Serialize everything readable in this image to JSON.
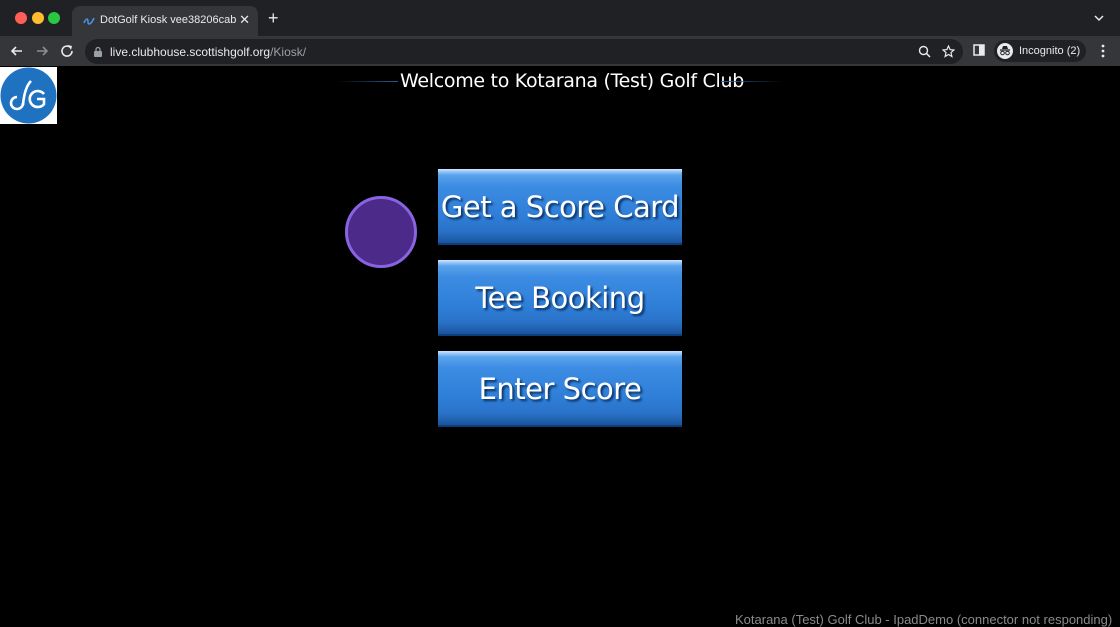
{
  "browser": {
    "tab_title": "DotGolf Kiosk vee38206cab",
    "tab_close": "✕",
    "new_tab": "+",
    "url_host": "live.clubhouse.scottishgolf.org",
    "url_path": "/Kiosk/",
    "profile_label": "Incognito (2)"
  },
  "page": {
    "welcome": "Welcome to Kotarana (Test) Golf Club",
    "buttons": {
      "score_card": "Get a Score Card",
      "tee_booking": "Tee Booking",
      "enter_score": "Enter Score"
    },
    "status": "Kotarana (Test) Golf Club - IpadDemo (connector not responding)"
  },
  "colors": {
    "button_blue": "#2f7fd9",
    "cursor_purple": "#4b2a8a",
    "logo_blue": "#1f72c0"
  },
  "icons": [
    "back-icon",
    "forward-icon",
    "reload-icon",
    "lock-icon",
    "zoom-icon",
    "star-icon",
    "side-panel-icon",
    "incognito-icon",
    "menu-icon",
    "dotgolf-logo"
  ]
}
